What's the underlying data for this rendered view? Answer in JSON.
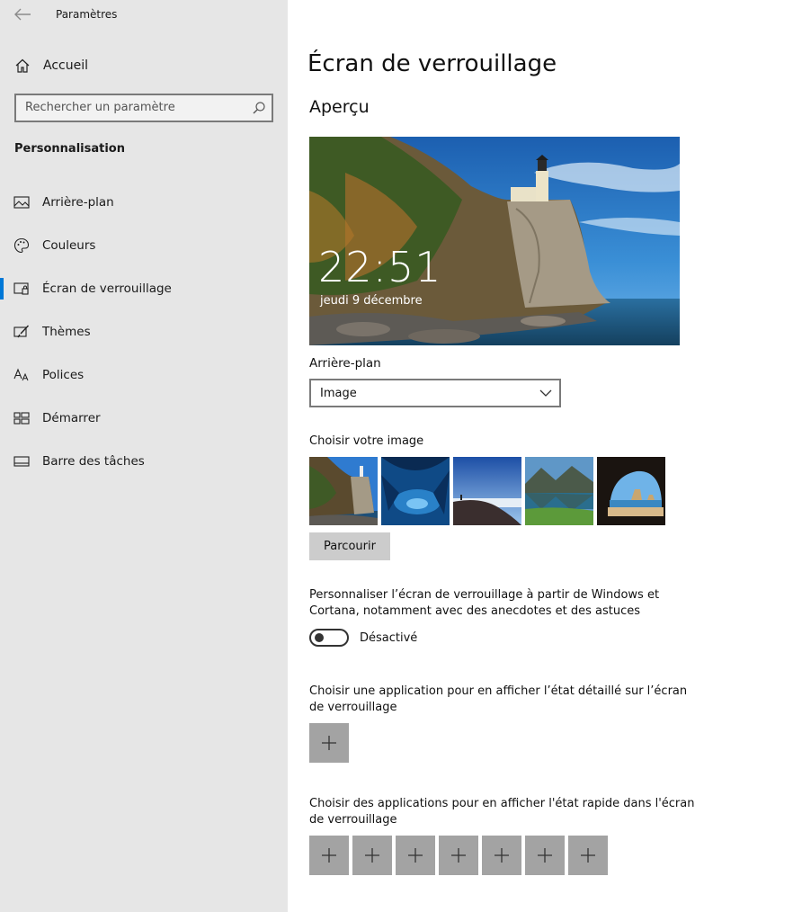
{
  "window": {
    "title": "Paramètres"
  },
  "sidebar": {
    "home_label": "Accueil",
    "search_placeholder": "Rechercher un paramètre",
    "section_title": "Personnalisation",
    "items": [
      {
        "label": "Arrière-plan",
        "icon": "picture-icon"
      },
      {
        "label": "Couleurs",
        "icon": "palette-icon"
      },
      {
        "label": "Écran de verrouillage",
        "icon": "lock-screen-icon",
        "active": true
      },
      {
        "label": "Thèmes",
        "icon": "theme-brush-icon"
      },
      {
        "label": "Polices",
        "icon": "font-icon"
      },
      {
        "label": "Démarrer",
        "icon": "start-grid-icon"
      },
      {
        "label": "Barre des tâches",
        "icon": "taskbar-icon"
      }
    ],
    "accent_color": "#0078d7"
  },
  "main": {
    "title": "Écran de verrouillage",
    "preview_heading": "Aperçu",
    "preview": {
      "time": "22:51",
      "date": "jeudi 9 décembre"
    },
    "background_label": "Arrière-plan",
    "background_value": "Image",
    "choose_image_label": "Choisir votre image",
    "thumbnails": [
      "lighthouse-cliff",
      "ice-cave",
      "mountain-sky",
      "lake-mountains",
      "beach-cave"
    ],
    "browse_label": "Parcourir",
    "personalize_text": "Personnaliser l’écran de verrouillage à partir de Windows et Cortana, notamment avec des anecdotes et des astuces",
    "toggle_state": "Désactivé",
    "detailed_status_text": "Choisir une application pour en afficher l’état détaillé sur l’écran de verrouillage",
    "quick_status_text": "Choisir des applications pour en afficher l'état rapide dans l'écran de verrouillage",
    "quick_slots_count": 7
  }
}
